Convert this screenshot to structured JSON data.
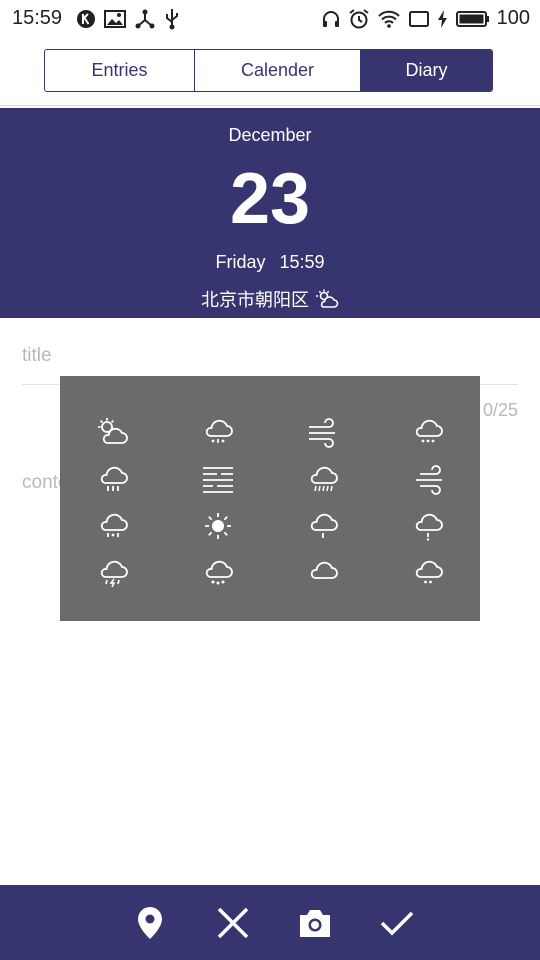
{
  "status_bar": {
    "time": "15:59",
    "battery": "100",
    "left_icons": [
      "k-badge-icon",
      "image-icon",
      "share-hub-icon",
      "usb-icon"
    ],
    "right_icons": [
      "headphones-icon",
      "alarm-icon",
      "wifi-icon",
      "screen-icon",
      "charging-icon",
      "battery-icon"
    ]
  },
  "tabs": [
    {
      "label": "Entries",
      "active": false
    },
    {
      "label": "Calender",
      "active": false
    },
    {
      "label": "Diary",
      "active": true
    }
  ],
  "header": {
    "month": "December",
    "day": "23",
    "weekday": "Friday",
    "time": "15:59",
    "location": "北京市朝阳区",
    "weather_icon": "partly-cloudy-icon"
  },
  "form": {
    "title_placeholder": "title",
    "counter": "0/25",
    "content_placeholder": "content"
  },
  "weather_picker": {
    "rows": [
      [
        "partly-cloudy-icon",
        "sleet-icon",
        "wind-icon",
        "snow-cloud-icon"
      ],
      [
        "rain-icon",
        "fog-icon",
        "heavy-rain-icon",
        "wind-icon"
      ],
      [
        "showers-icon",
        "sun-icon",
        "light-rain-icon",
        "drizzle-icon"
      ],
      [
        "thunder-rain-icon",
        "snow-icon",
        "cloud-icon",
        "sprinkle-icon"
      ]
    ]
  },
  "bottom_bar": {
    "actions": [
      "location-pin-icon",
      "close-icon",
      "camera-icon",
      "check-icon"
    ]
  },
  "colors": {
    "primary": "#36356f",
    "overlay": "#6b6b6b",
    "placeholder": "#b9b9b9"
  }
}
